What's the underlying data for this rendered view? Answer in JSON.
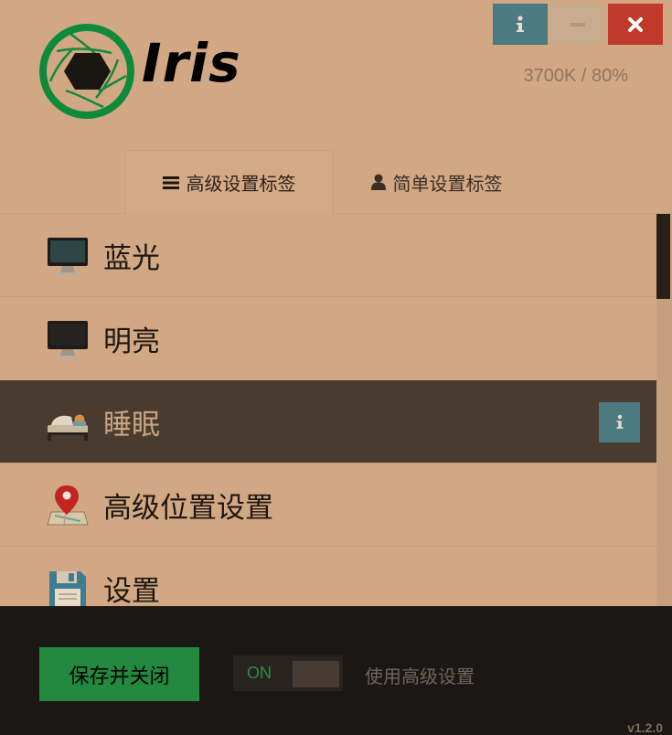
{
  "app": {
    "logo_text": "Iris",
    "status": "3700K / 80%",
    "version": "v1.2.0"
  },
  "window_controls": {
    "info_icon": "info-icon",
    "minimize_icon": "minimize-icon",
    "close_icon": "close-icon",
    "colors": {
      "info": "#4b7a80",
      "minimize": "#c9ab8d",
      "close": "#c0392b"
    }
  },
  "tabs": [
    {
      "label": "高级设置标签",
      "icon": "menu-icon",
      "active": true
    },
    {
      "label": "简单设置标签",
      "icon": "user-icon",
      "active": false
    }
  ],
  "list": {
    "items": [
      {
        "label": "蓝光",
        "icon": "monitor-icon",
        "active": false
      },
      {
        "label": "明亮",
        "icon": "monitor-icon",
        "active": false
      },
      {
        "label": "睡眠",
        "icon": "bed-icon",
        "active": true,
        "has_info": true
      },
      {
        "label": "高级位置设置",
        "icon": "map-pin-icon",
        "active": false
      },
      {
        "label": "设置",
        "icon": "floppy-disk-icon",
        "active": false
      }
    ]
  },
  "footer": {
    "save_label": "保存并关闭",
    "toggle_state": "ON",
    "toggle_text": "使用高级设置"
  },
  "colors": {
    "background": "#d1a883",
    "active_row": "#4a3b30",
    "footer": "#1b1714",
    "accent_green": "#22893e",
    "teal": "#4b7a80"
  }
}
